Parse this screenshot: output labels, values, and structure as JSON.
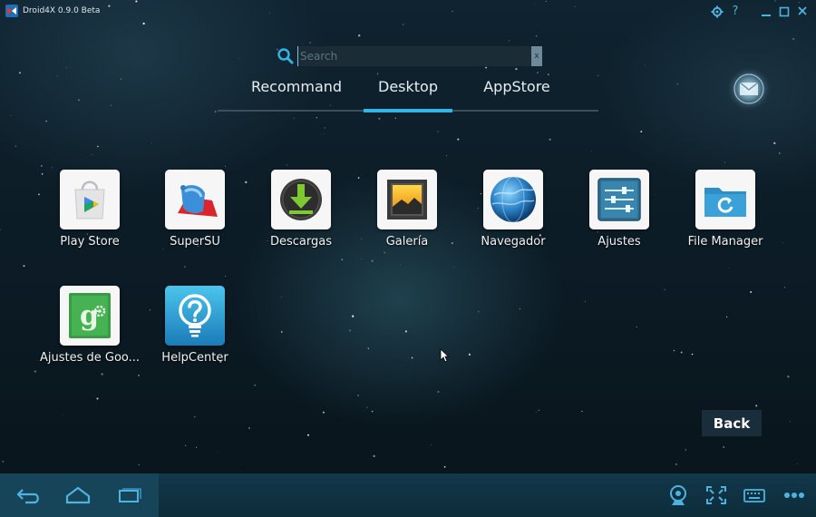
{
  "window": {
    "title": "Droid4X 0.9.0 Beta"
  },
  "search": {
    "placeholder": "Search",
    "value": "",
    "clear_label": "x"
  },
  "tabs": [
    {
      "label": "Recommand",
      "active": false
    },
    {
      "label": "Desktop",
      "active": true
    },
    {
      "label": "AppStore",
      "active": false
    }
  ],
  "apps": [
    {
      "label": "Play Store",
      "icon": "play-store-icon"
    },
    {
      "label": "SuperSU",
      "icon": "supersu-icon"
    },
    {
      "label": "Descargas",
      "icon": "downloads-icon"
    },
    {
      "label": "Galería",
      "icon": "gallery-icon"
    },
    {
      "label": "Navegador",
      "icon": "browser-icon"
    },
    {
      "label": "Ajustes",
      "icon": "settings-icon"
    },
    {
      "label": "File Manager",
      "icon": "file-manager-icon"
    },
    {
      "label": "Ajustes de Goo...",
      "icon": "google-settings-icon"
    },
    {
      "label": "HelpCenter",
      "icon": "helpcenter-icon"
    }
  ],
  "back_button": {
    "label": "Back"
  },
  "colors": {
    "accent": "#33b5e5",
    "navbar": "#12384a",
    "icon_blue": "#4fb3df"
  }
}
